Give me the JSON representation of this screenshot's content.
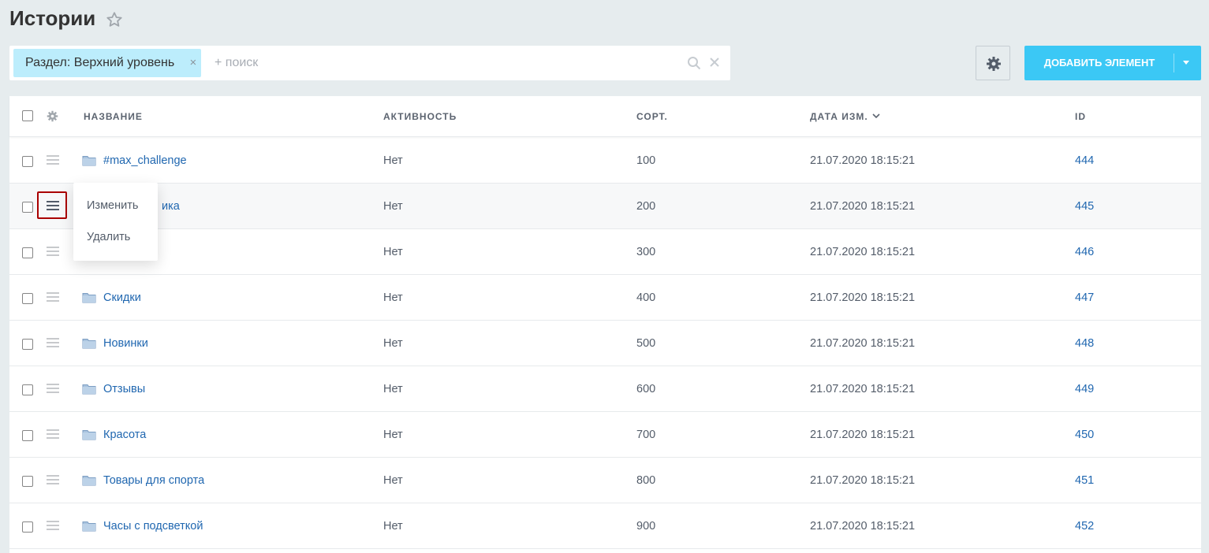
{
  "page": {
    "title": "Истории"
  },
  "filter": {
    "chip_label": "Раздел: Верхний уровень",
    "chip_close": "×",
    "search_placeholder": "+ поиск"
  },
  "toolbar": {
    "add_label": "ДОБАВИТЬ ЭЛЕМЕНТ"
  },
  "grid": {
    "columns": [
      "НАЗВАНИЕ",
      "АКТИВНОСТЬ",
      "СОРТ.",
      "ДАТА ИЗМ.",
      "ID"
    ],
    "rows": [
      {
        "name": "#max_challenge",
        "active": "Нет",
        "sort": "100",
        "date": "21.07.2020 18:15:21",
        "id": "444"
      },
      {
        "name": "ика",
        "active": "Нет",
        "sort": "200",
        "date": "21.07.2020 18:15:21",
        "id": "445"
      },
      {
        "name": "",
        "active": "Нет",
        "sort": "300",
        "date": "21.07.2020 18:15:21",
        "id": "446"
      },
      {
        "name": "Скидки",
        "active": "Нет",
        "sort": "400",
        "date": "21.07.2020 18:15:21",
        "id": "447"
      },
      {
        "name": "Новинки",
        "active": "Нет",
        "sort": "500",
        "date": "21.07.2020 18:15:21",
        "id": "448"
      },
      {
        "name": "Отзывы",
        "active": "Нет",
        "sort": "600",
        "date": "21.07.2020 18:15:21",
        "id": "449"
      },
      {
        "name": "Красота",
        "active": "Нет",
        "sort": "700",
        "date": "21.07.2020 18:15:21",
        "id": "450"
      },
      {
        "name": "Товары для спорта",
        "active": "Нет",
        "sort": "800",
        "date": "21.07.2020 18:15:21",
        "id": "451"
      },
      {
        "name": "Часы с подсветкой",
        "active": "Нет",
        "sort": "900",
        "date": "21.07.2020 18:15:21",
        "id": "452"
      }
    ]
  },
  "context_menu": {
    "items": [
      "Изменить",
      "Удалить"
    ]
  },
  "colors": {
    "accent": "#3bc8f5",
    "link": "#2067b0",
    "chip": "#bcedfc",
    "highlight_border": "#aa0000"
  }
}
